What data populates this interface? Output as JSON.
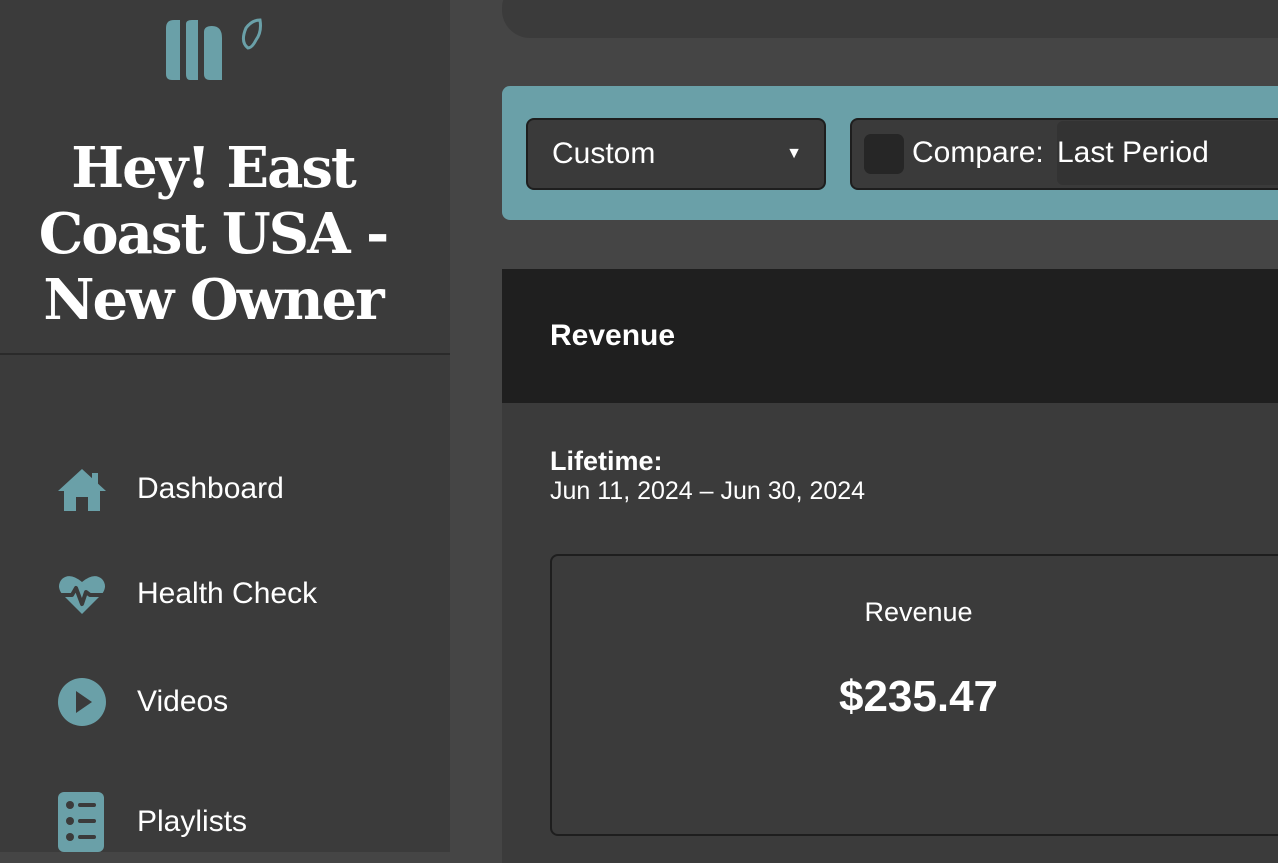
{
  "sidebar": {
    "logo_icon": "leaf-logo-icon",
    "channel_title": "Hey! East Coast USA - New Owner",
    "accent_color": "#6aa0a8",
    "items": [
      {
        "label": "Dashboard",
        "icon": "home-icon"
      },
      {
        "label": "Health Check",
        "icon": "heartbeat-icon"
      },
      {
        "label": "Videos",
        "icon": "play-circle-icon"
      },
      {
        "label": "Playlists",
        "icon": "list-icon"
      }
    ]
  },
  "filters": {
    "range_value": "Custom",
    "compare_label": "Compare:",
    "compare_value": "Last Period",
    "compare_checked": false
  },
  "revenue": {
    "section_title": "Revenue",
    "lifetime_label": "Lifetime:",
    "lifetime_range": "Jun 11, 2024 – Jun 30, 2024",
    "card_label": "Revenue",
    "card_value": "$235.47"
  }
}
